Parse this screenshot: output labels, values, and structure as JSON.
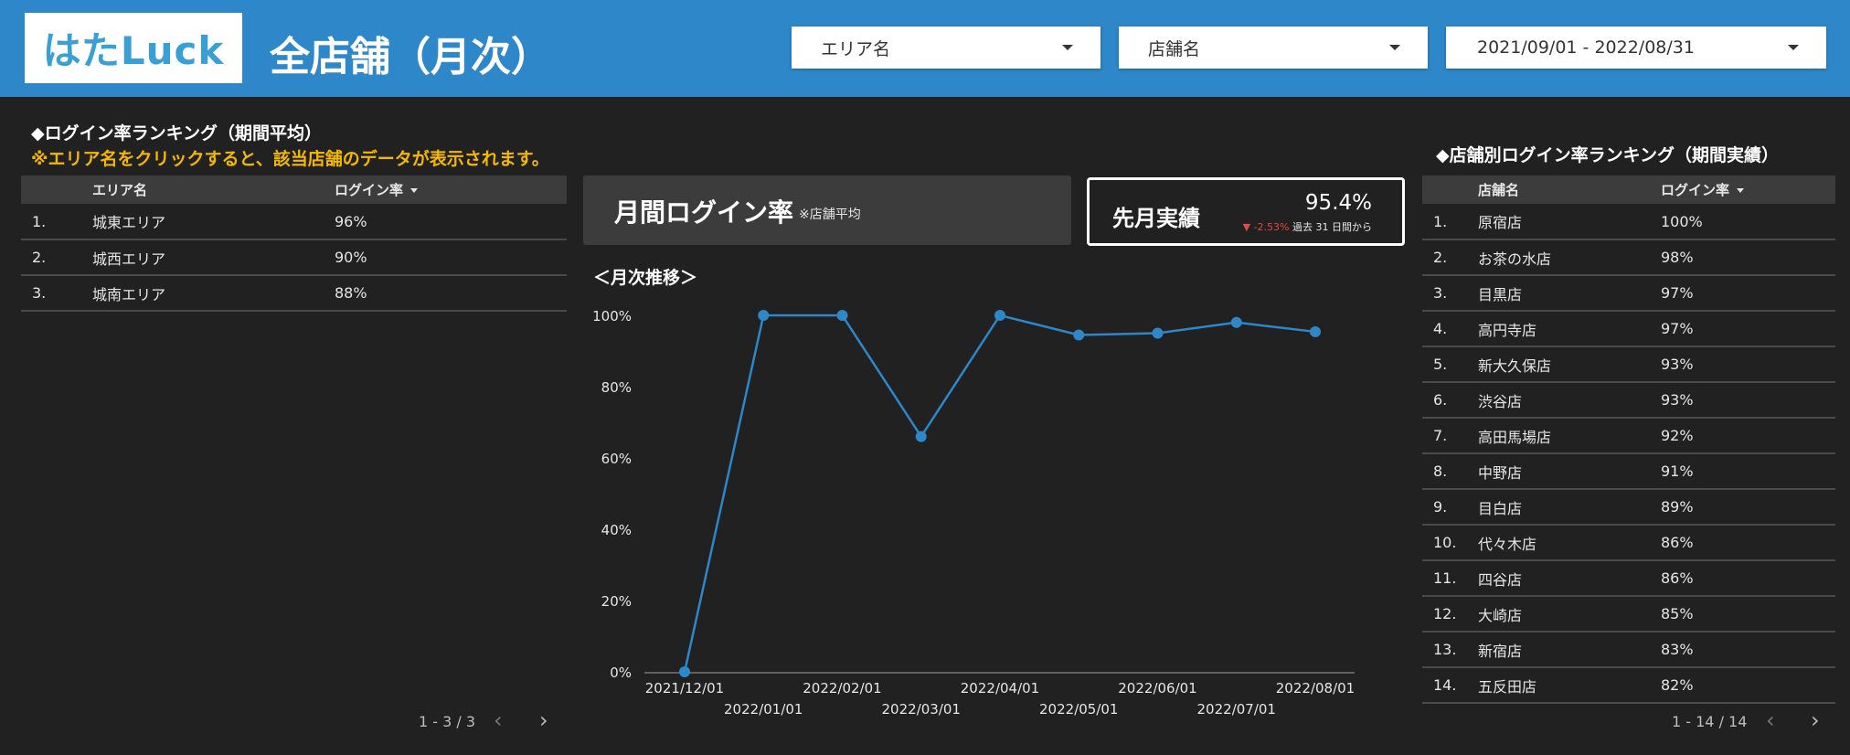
{
  "header": {
    "logo_text": "はたLuck",
    "page_title": "全店舗（月次）",
    "filters": {
      "area": "エリア名",
      "store": "店舗名",
      "date_range": "2021/09/01 - 2022/08/31"
    },
    "colors": {
      "bar": "#2d87c8"
    }
  },
  "left_panel": {
    "title": "◆ログイン率ランキング（期間平均）",
    "notice": "※エリア名をクリックすると、該当店舗のデータが表示されます。",
    "columns": [
      "エリア名",
      "ログイン率"
    ],
    "rows": [
      {
        "rank": "1.",
        "name": "城東エリア",
        "rate": "96%"
      },
      {
        "rank": "2.",
        "name": "城西エリア",
        "rate": "90%"
      },
      {
        "rank": "3.",
        "name": "城南エリア",
        "rate": "88%"
      }
    ],
    "pager": "1 - 3 / 3"
  },
  "kpi": {
    "title": "月間ログイン率",
    "note": "※店舗平均"
  },
  "scorecard": {
    "label": "先月実績",
    "value": "95.4%",
    "delta": "-2.53%",
    "delta_suffix": "過去 31 日間から"
  },
  "chart_title": "＜月次推移＞",
  "chart_data": {
    "type": "line",
    "x": [
      "2021/12/01",
      "2022/01/01",
      "2022/02/01",
      "2022/03/01",
      "2022/04/01",
      "2022/05/01",
      "2022/06/01",
      "2022/07/01",
      "2022/08/01"
    ],
    "values": [
      0,
      100,
      100,
      66,
      100,
      94.5,
      95,
      98,
      95.4
    ],
    "ylim": [
      0,
      100
    ],
    "yticks": [
      "0%",
      "20%",
      "40%",
      "60%",
      "80%",
      "100%"
    ],
    "color": "#2d87c8",
    "grid": false
  },
  "right_panel": {
    "title": "◆店舗別ログイン率ランキング（期間実績）",
    "columns": [
      "店舗名",
      "ログイン率"
    ],
    "rows": [
      {
        "rank": "1.",
        "name": "原宿店",
        "rate": "100%"
      },
      {
        "rank": "2.",
        "name": "お茶の水店",
        "rate": "98%"
      },
      {
        "rank": "3.",
        "name": "目黒店",
        "rate": "97%"
      },
      {
        "rank": "4.",
        "name": "高円寺店",
        "rate": "97%"
      },
      {
        "rank": "5.",
        "name": "新大久保店",
        "rate": "93%"
      },
      {
        "rank": "6.",
        "name": "渋谷店",
        "rate": "93%"
      },
      {
        "rank": "7.",
        "name": "高田馬場店",
        "rate": "92%"
      },
      {
        "rank": "8.",
        "name": "中野店",
        "rate": "91%"
      },
      {
        "rank": "9.",
        "name": "目白店",
        "rate": "89%"
      },
      {
        "rank": "10.",
        "name": "代々木店",
        "rate": "86%"
      },
      {
        "rank": "11.",
        "name": "四谷店",
        "rate": "86%"
      },
      {
        "rank": "12.",
        "name": "大崎店",
        "rate": "85%"
      },
      {
        "rank": "13.",
        "name": "新宿店",
        "rate": "83%"
      },
      {
        "rank": "14.",
        "name": "五反田店",
        "rate": "82%"
      }
    ],
    "pager": "1 - 14 / 14"
  }
}
